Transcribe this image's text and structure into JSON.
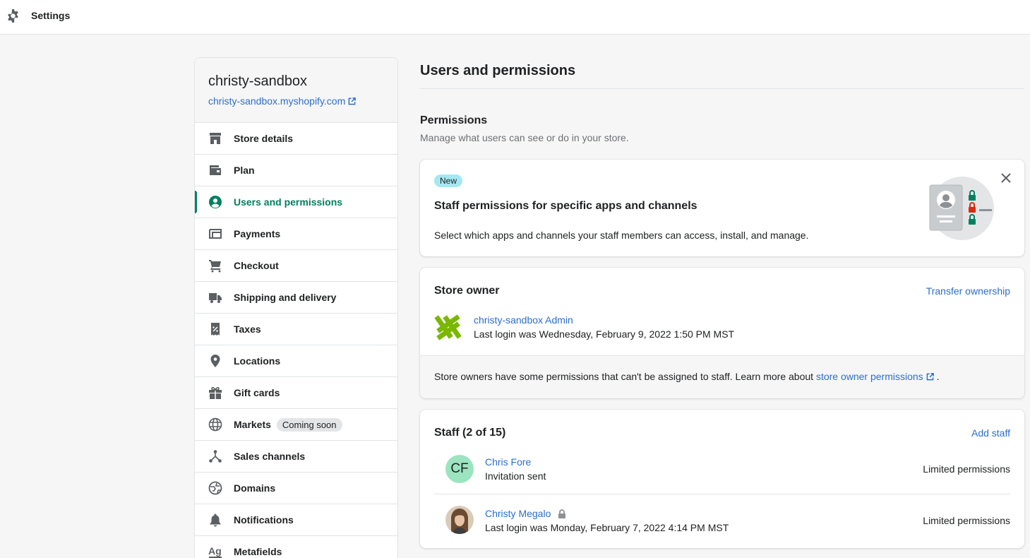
{
  "topbar": {
    "title": "Settings",
    "icon": "gear-icon"
  },
  "sidebar": {
    "store_name": "christy-sandbox",
    "store_url": "christy-sandbox.myshopify.com",
    "items": [
      {
        "label": "Store details",
        "icon": "store-icon"
      },
      {
        "label": "Plan",
        "icon": "wallet-icon"
      },
      {
        "label": "Users and permissions",
        "icon": "user-circle-icon",
        "active": true
      },
      {
        "label": "Payments",
        "icon": "payments-icon"
      },
      {
        "label": "Checkout",
        "icon": "cart-icon"
      },
      {
        "label": "Shipping and delivery",
        "icon": "truck-icon"
      },
      {
        "label": "Taxes",
        "icon": "tax-receipt-icon"
      },
      {
        "label": "Locations",
        "icon": "location-pin-icon"
      },
      {
        "label": "Gift cards",
        "icon": "gift-icon"
      },
      {
        "label": "Markets",
        "icon": "globe-icon",
        "badge": "Coming soon"
      },
      {
        "label": "Sales channels",
        "icon": "channels-icon"
      },
      {
        "label": "Domains",
        "icon": "globe-web-icon"
      },
      {
        "label": "Notifications",
        "icon": "bell-icon"
      },
      {
        "label": "Metafields",
        "icon": "metafields-icon"
      }
    ]
  },
  "main": {
    "title": "Users and permissions",
    "permissions": {
      "title": "Permissions",
      "description": "Manage what users can see or do in your store."
    },
    "banner": {
      "badge": "New",
      "title": "Staff permissions for specific apps and channels",
      "description": "Select which apps and channels your staff members can access, install, and manage."
    },
    "owner": {
      "title": "Store owner",
      "action": "Transfer ownership",
      "name": "christy-sandbox Admin",
      "last_login": "Last login was Wednesday, February 9, 2022 1:50 PM MST",
      "note_prefix": "Store owners have some permissions that can't be assigned to staff. Learn more about",
      "note_link": "store owner permissions",
      "note_suffix": "."
    },
    "staff": {
      "title": "Staff (2 of 15)",
      "action": "Add staff",
      "members": [
        {
          "initials": "CF",
          "name": "Chris Fore",
          "status": "Invitation sent",
          "permissions": "Limited permissions"
        },
        {
          "name": "Christy Megalo",
          "status": "Last login was Monday, February 7, 2022 4:14 PM MST",
          "permissions": "Limited permissions"
        }
      ]
    }
  },
  "colors": {
    "accent": "#008060",
    "link": "#2c6ecb",
    "badge_new": "#a4e8f2",
    "avatar_cf": "#9ce4bf"
  }
}
